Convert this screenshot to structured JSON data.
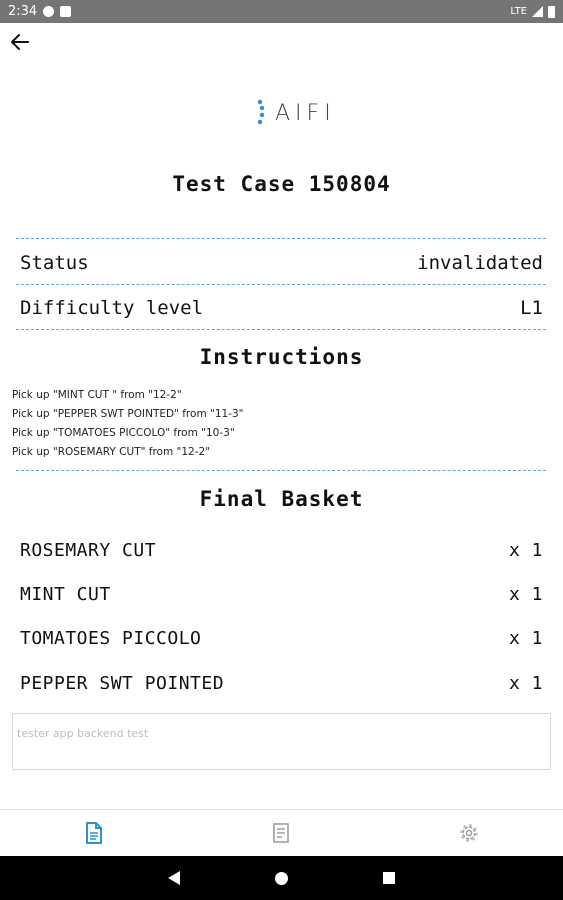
{
  "status_bar": {
    "time": "2:34",
    "network": "LTE"
  },
  "logo": {
    "text": "AIFI"
  },
  "title": "Test Case 150804",
  "info": [
    {
      "label": "Status",
      "value": "invalidated"
    },
    {
      "label": "Difficulty level",
      "value": "L1"
    }
  ],
  "instructions": {
    "heading": "Instructions",
    "lines": [
      "Pick up \"MINT CUT \" from \"12-2\"",
      "Pick up \"PEPPER SWT POINTED\" from \"11-3\"",
      "Pick up \"TOMATOES PICCOLO\" from \"10-3\"",
      "Pick up \"ROSEMARY CUT\" from \"12-2\""
    ]
  },
  "basket": {
    "heading": "Final Basket",
    "items": [
      {
        "name": "ROSEMARY CUT",
        "qty": "x 1"
      },
      {
        "name": "MINT CUT",
        "qty": "x 1"
      },
      {
        "name": "TOMATOES PICCOLO",
        "qty": "x 1"
      },
      {
        "name": "PEPPER SWT POINTED",
        "qty": "x 1"
      }
    ]
  },
  "note_field": {
    "placeholder": "tester app backend test"
  },
  "colors": {
    "accent": "#2f8fd0",
    "divider": "#5aa9d6",
    "inactive_icon": "#9e9e9e"
  }
}
